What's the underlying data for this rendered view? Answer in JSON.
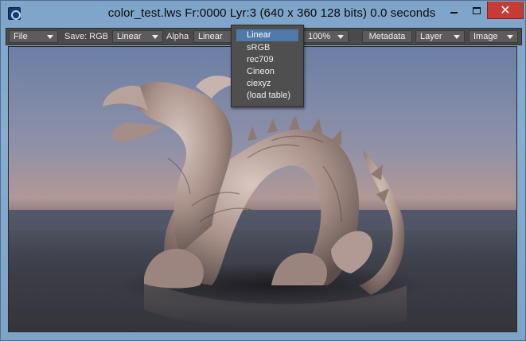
{
  "window": {
    "title": "color_test.lws Fr:0000 Lyr:3  (640 x 360 128 bits) 0.0 seconds",
    "minimize_glyph": "",
    "maximize_glyph": "",
    "close_glyph": "✕",
    "app_icon": "lightwave-icon"
  },
  "toolbar": {
    "file_label": "File",
    "save_label": "Save: RGB",
    "save_colorspace": "Linear",
    "alpha_label": "Alpha",
    "alpha_colorspace": "Linear",
    "zoom": "100%",
    "metadata_label": "Metadata",
    "layer_label": "Layer",
    "image_label": "Image"
  },
  "colorspace_menu": {
    "items": [
      "Linear",
      "sRGB",
      "rec709",
      "Cineon",
      "ciexyz",
      "(load table)"
    ],
    "selected": "Linear"
  },
  "colors": {
    "selection": "#4f79a8",
    "close_button": "#c43c35",
    "toolbar_bg": "#4a4a4a",
    "window_frame": "#7ea5c9"
  }
}
